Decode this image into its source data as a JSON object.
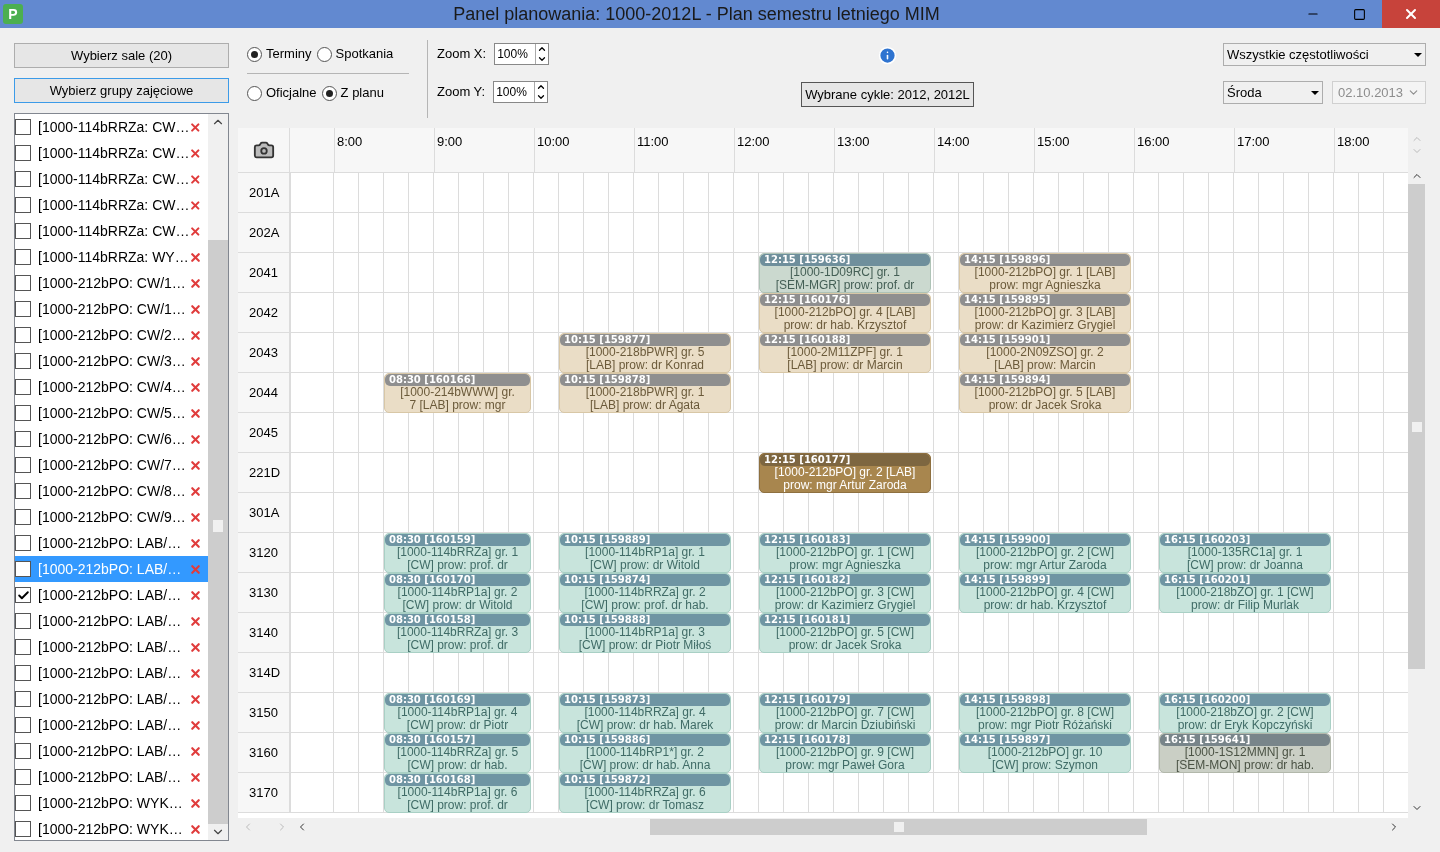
{
  "window": {
    "title": "Panel planowania: 1000-2012L - Plan semestru letniego MIM",
    "app_icon": "P"
  },
  "left_panel": {
    "buttons": [
      {
        "label": "Wybierz sale (20)",
        "focused": false
      },
      {
        "label": "Wybierz grupy zajęciowe",
        "focused": true
      }
    ],
    "groups": [
      {
        "label": "[1000-114bRRZa: CW…",
        "checked": false,
        "selected": false
      },
      {
        "label": "[1000-114bRRZa: CW…",
        "checked": false,
        "selected": false
      },
      {
        "label": "[1000-114bRRZa: CW…",
        "checked": false,
        "selected": false
      },
      {
        "label": "[1000-114bRRZa: CW…",
        "checked": false,
        "selected": false
      },
      {
        "label": "[1000-114bRRZa: CW…",
        "checked": false,
        "selected": false
      },
      {
        "label": "[1000-114bRRZa: WY…",
        "checked": false,
        "selected": false
      },
      {
        "label": "[1000-212bPO: CW/1…",
        "checked": false,
        "selected": false
      },
      {
        "label": "[1000-212bPO: CW/1…",
        "checked": false,
        "selected": false
      },
      {
        "label": "[1000-212bPO: CW/2…",
        "checked": false,
        "selected": false
      },
      {
        "label": "[1000-212bPO: CW/3…",
        "checked": false,
        "selected": false
      },
      {
        "label": "[1000-212bPO: CW/4…",
        "checked": false,
        "selected": false
      },
      {
        "label": "[1000-212bPO: CW/5…",
        "checked": false,
        "selected": false
      },
      {
        "label": "[1000-212bPO: CW/6…",
        "checked": false,
        "selected": false
      },
      {
        "label": "[1000-212bPO: CW/7…",
        "checked": false,
        "selected": false
      },
      {
        "label": "[1000-212bPO: CW/8…",
        "checked": false,
        "selected": false
      },
      {
        "label": "[1000-212bPO: CW/9…",
        "checked": false,
        "selected": false
      },
      {
        "label": "[1000-212bPO: LAB/…",
        "checked": false,
        "selected": false
      },
      {
        "label": "[1000-212bPO: LAB/…",
        "checked": false,
        "selected": true
      },
      {
        "label": "[1000-212bPO: LAB/…",
        "checked": true,
        "selected": false
      },
      {
        "label": "[1000-212bPO: LAB/…",
        "checked": false,
        "selected": false
      },
      {
        "label": "[1000-212bPO: LAB/…",
        "checked": false,
        "selected": false
      },
      {
        "label": "[1000-212bPO: LAB/…",
        "checked": false,
        "selected": false
      },
      {
        "label": "[1000-212bPO: LAB/…",
        "checked": false,
        "selected": false
      },
      {
        "label": "[1000-212bPO: LAB/…",
        "checked": false,
        "selected": false
      },
      {
        "label": "[1000-212bPO: LAB/…",
        "checked": false,
        "selected": false
      },
      {
        "label": "[1000-212bPO: LAB/…",
        "checked": false,
        "selected": false
      },
      {
        "label": "[1000-212bPO: WYK…",
        "checked": false,
        "selected": false
      },
      {
        "label": "[1000-212bPO: WYK…",
        "checked": false,
        "selected": false
      }
    ]
  },
  "toolbar": {
    "view_radios": [
      {
        "label": "Terminy",
        "selected": true
      },
      {
        "label": "Spotkania",
        "selected": false
      }
    ],
    "source_radios": [
      {
        "label": "Oficjalne",
        "selected": false
      },
      {
        "label": "Z planu",
        "selected": true
      }
    ],
    "zoom_x": {
      "label": "Zoom X:",
      "value": "100%"
    },
    "zoom_y": {
      "label": "Zoom Y:",
      "value": "100%"
    },
    "cycles_button": "Wybrane cykle: 2012, 2012L",
    "frequency": "Wszystkie częstotliwości",
    "day": "Środa",
    "date": {
      "value": "02.10.2013",
      "disabled": true
    }
  },
  "schedule": {
    "hours": [
      "8:00",
      "9:00",
      "10:00",
      "11:00",
      "12:00",
      "13:00",
      "14:00",
      "15:00",
      "16:00",
      "17:00",
      "18:00"
    ],
    "rooms": [
      {
        "name": "201A"
      },
      {
        "name": "202A"
      },
      {
        "name": "2041",
        "events": [
          {
            "kind": "seminar",
            "time": "12:15",
            "code": "[159636]",
            "lines": [
              "[1000-1D09RC] gr. 1",
              "[SEM-MGR] prow: prof. dr"
            ]
          },
          {
            "kind": "lab",
            "time": "14:15",
            "code": "[159896]",
            "lines": [
              "[1000-212bPO] gr. 1 [LAB]",
              "prow: mgr Agnieszka"
            ]
          }
        ]
      },
      {
        "name": "2042",
        "events": [
          {
            "kind": "lab",
            "time": "12:15",
            "code": "[160176]",
            "lines": [
              "[1000-212bPO] gr. 4 [LAB]",
              "prow: dr hab. Krzysztof"
            ]
          },
          {
            "kind": "lab",
            "time": "14:15",
            "code": "[159895]",
            "lines": [
              "[1000-212bPO] gr. 3 [LAB]",
              "prow: dr Kazimierz Grygiel"
            ]
          }
        ]
      },
      {
        "name": "2043",
        "events": [
          {
            "kind": "lab",
            "time": "10:15",
            "code": "[159877]",
            "lines": [
              "[1000-218bPWR] gr. 5",
              "[LAB] prow: dr Konrad"
            ]
          },
          {
            "kind": "lab",
            "time": "12:15",
            "code": "[160188]",
            "lines": [
              "[1000-2M11ZPF] gr. 1",
              "[LAB] prow: dr Marcin"
            ]
          },
          {
            "kind": "lab",
            "time": "14:15",
            "code": "[159901]",
            "lines": [
              "[1000-2N09ZSO] gr. 2",
              "[LAB] prow: Marcin"
            ]
          }
        ]
      },
      {
        "name": "2044",
        "events": [
          {
            "kind": "lab",
            "time": "08:30",
            "code": "[160166]",
            "lines": [
              "[1000-214bWWW] gr.",
              "7 [LAB] prow: mgr"
            ]
          },
          {
            "kind": "lab",
            "time": "10:15",
            "code": "[159878]",
            "lines": [
              "[1000-218bPWR] gr. 1",
              "[LAB] prow: dr Agata"
            ]
          },
          {
            "kind": "lab",
            "time": "14:15",
            "code": "[159894]",
            "lines": [
              "[1000-212bPO] gr. 5 [LAB]",
              "prow: dr Jacek Sroka"
            ]
          }
        ]
      },
      {
        "name": "2045"
      },
      {
        "name": "221D",
        "events": [
          {
            "kind": "highlighted",
            "time": "12:15",
            "code": "[160177]",
            "lines": [
              "[1000-212bPO] gr. 2 [LAB]",
              "prow: mgr Artur Zaroda"
            ]
          }
        ]
      },
      {
        "name": "301A"
      },
      {
        "name": "3120",
        "events": [
          {
            "kind": "exercise",
            "time": "08:30",
            "code": "[160159]",
            "lines": [
              "[1000-114bRRZa] gr. 1",
              "[CW] prow: prof. dr"
            ]
          },
          {
            "kind": "exercise",
            "time": "10:15",
            "code": "[159889]",
            "lines": [
              "[1000-114bRP1a] gr. 1",
              "[CW] prow: dr Witold"
            ]
          },
          {
            "kind": "exercise",
            "time": "12:15",
            "code": "[160183]",
            "lines": [
              "[1000-212bPO] gr. 1 [CW]",
              "prow: mgr Agnieszka"
            ]
          },
          {
            "kind": "exercise",
            "time": "14:15",
            "code": "[159900]",
            "lines": [
              "[1000-212bPO] gr. 2 [CW]",
              "prow: mgr Artur Zaroda"
            ]
          },
          {
            "kind": "exercise",
            "time": "16:15",
            "code": "[160203]",
            "lines": [
              "[1000-135RC1a] gr. 1",
              "[CW] prow: dr Joanna"
            ]
          }
        ]
      },
      {
        "name": "3130",
        "events": [
          {
            "kind": "exercise",
            "time": "08:30",
            "code": "[160170]",
            "lines": [
              "[1000-114bRP1a] gr. 2",
              "[CW] prow: dr Witold"
            ]
          },
          {
            "kind": "exercise",
            "time": "10:15",
            "code": "[159874]",
            "lines": [
              "[1000-114bRRZa] gr. 2",
              "[CW] prow: prof. dr hab."
            ]
          },
          {
            "kind": "exercise",
            "time": "12:15",
            "code": "[160182]",
            "lines": [
              "[1000-212bPO] gr. 3 [CW]",
              "prow: dr Kazimierz Grygiel"
            ]
          },
          {
            "kind": "exercise",
            "time": "14:15",
            "code": "[159899]",
            "lines": [
              "[1000-212bPO] gr. 4 [CW]",
              "prow: dr hab. Krzysztof"
            ]
          },
          {
            "kind": "exercise",
            "time": "16:15",
            "code": "[160201]",
            "lines": [
              "[1000-218bZO] gr. 1 [CW]",
              "prow: dr Filip Murlak"
            ]
          }
        ]
      },
      {
        "name": "3140",
        "events": [
          {
            "kind": "exercise",
            "time": "08:30",
            "code": "[160158]",
            "lines": [
              "[1000-114bRRZa] gr. 3",
              "[CW] prow: prof. dr"
            ]
          },
          {
            "kind": "exercise",
            "time": "10:15",
            "code": "[159888]",
            "lines": [
              "[1000-114bRP1a] gr. 3",
              "[CW] prow: dr Piotr Miłoś"
            ]
          },
          {
            "kind": "exercise",
            "time": "12:15",
            "code": "[160181]",
            "lines": [
              "[1000-212bPO] gr. 5 [CW]",
              "prow: dr Jacek Sroka"
            ]
          }
        ]
      },
      {
        "name": "314D"
      },
      {
        "name": "3150",
        "events": [
          {
            "kind": "exercise",
            "time": "08:30",
            "code": "[160169]",
            "lines": [
              "[1000-114bRP1a] gr. 4",
              "[CW] prow: dr Piotr"
            ]
          },
          {
            "kind": "exercise",
            "time": "10:15",
            "code": "[159873]",
            "lines": [
              "[1000-114bRRZa] gr. 4",
              "[CW] prow: dr hab. Marek"
            ]
          },
          {
            "kind": "exercise",
            "time": "12:15",
            "code": "[160179]",
            "lines": [
              "[1000-212bPO] gr. 7 [CW]",
              "prow: dr Marcin Dziubiński"
            ]
          },
          {
            "kind": "exercise",
            "time": "14:15",
            "code": "[159898]",
            "lines": [
              "[1000-212bPO] gr. 8 [CW]",
              "prow: mgr Piotr Różański"
            ]
          },
          {
            "kind": "exercise",
            "time": "16:15",
            "code": "[160200]",
            "lines": [
              "[1000-218bZO] gr. 2 [CW]",
              "prow: dr Eryk Kopczyński"
            ]
          }
        ]
      },
      {
        "name": "3160",
        "events": [
          {
            "kind": "exercise",
            "time": "08:30",
            "code": "[160157]",
            "lines": [
              "[1000-114bRRZa] gr. 5",
              "[CW] prow: dr hab."
            ]
          },
          {
            "kind": "exercise",
            "time": "10:15",
            "code": "[159886]",
            "lines": [
              "[1000-114bRP1*] gr. 2",
              "[CW] prow: dr hab. Anna"
            ]
          },
          {
            "kind": "exercise",
            "time": "12:15",
            "code": "[160178]",
            "lines": [
              "[1000-212bPO] gr. 9 [CW]",
              "prow: mgr Paweł Gora"
            ]
          },
          {
            "kind": "exercise",
            "time": "14:15",
            "code": "[159897]",
            "lines": [
              "[1000-212bPO] gr. 10",
              "[CW] prow: Szymon"
            ]
          },
          {
            "kind": "monographic",
            "time": "16:15",
            "code": "[159641]",
            "lines": [
              "[1000-1S12MMN] gr. 1",
              "[SEM-MON] prow: dr hab."
            ]
          }
        ]
      },
      {
        "name": "3170",
        "events": [
          {
            "kind": "exercise",
            "time": "08:30",
            "code": "[160168]",
            "lines": [
              "[1000-114bRP1a] gr. 6",
              "[CW] prow: prof. dr"
            ]
          },
          {
            "kind": "exercise",
            "time": "10:15",
            "code": "[159872]",
            "lines": [
              "[1000-114bRRZa] gr. 6",
              "[CW] prow: dr Tomasz"
            ]
          }
        ]
      }
    ]
  }
}
